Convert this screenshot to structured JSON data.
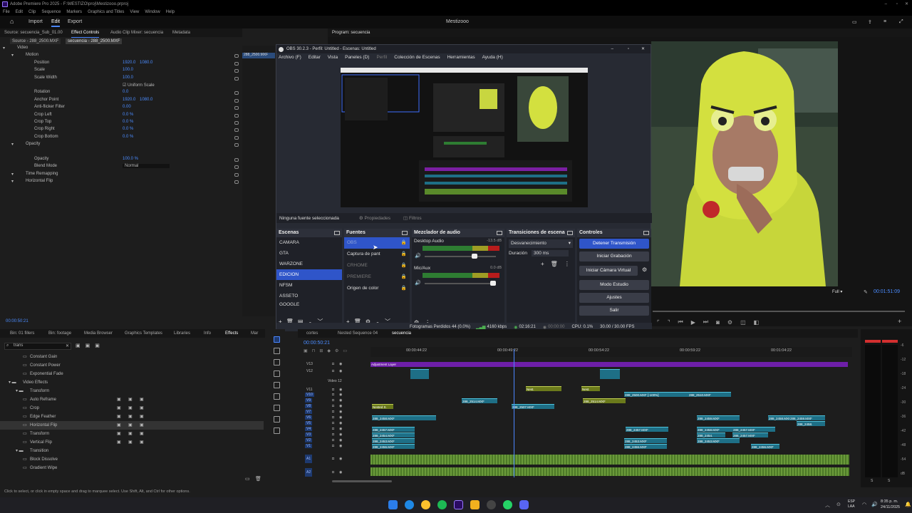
{
  "titlebar": {
    "title": "Adobe Premiere Pro 2025 - F:\\MESTIZO\\proj\\Mestizooo.prproj"
  },
  "menubar": [
    "File",
    "Edit",
    "Clip",
    "Sequence",
    "Markers",
    "Graphics and Titles",
    "View",
    "Window",
    "Help"
  ],
  "workspace": {
    "tabs": [
      "Import",
      "Edit",
      "Export"
    ],
    "active": "Edit",
    "project": "Mestizooo"
  },
  "top_panels": {
    "source": "Source: secuencia_Sub_01.00",
    "effect_controls": "Effect Controls",
    "audio_mixer": "Audio Clip Mixer: secuencia",
    "metadata": "Metadata",
    "program": "Program: secuencia"
  },
  "ec_subtabs": {
    "source": "Source - 288_2500.MXF",
    "seq": "secuencia - 288_2500.MXF",
    "clip_label": "288_2500.MXF"
  },
  "effect_controls": [
    {
      "name": "Video",
      "indent": 0,
      "v1": "",
      "v2": ""
    },
    {
      "name": "Motion",
      "indent": 1,
      "v1": "",
      "v2": ""
    },
    {
      "name": "Position",
      "indent": 2,
      "v1": "1920.0",
      "v2": "1080.0"
    },
    {
      "name": "Scale",
      "indent": 2,
      "v1": "100.0",
      "v2": ""
    },
    {
      "name": "Scale Width",
      "indent": 2,
      "v1": "100.0",
      "v2": ""
    },
    {
      "name": "",
      "indent": 2,
      "v1": "",
      "v2": "",
      "check": "Uniform Scale"
    },
    {
      "name": "Rotation",
      "indent": 2,
      "v1": "0.0",
      "v2": ""
    },
    {
      "name": "Anchor Point",
      "indent": 2,
      "v1": "1920.0",
      "v2": "1080.0"
    },
    {
      "name": "Anti-flicker Filter",
      "indent": 2,
      "v1": "0.00",
      "v2": ""
    },
    {
      "name": "Crop Left",
      "indent": 2,
      "v1": "0.0 %",
      "v2": ""
    },
    {
      "name": "Crop Top",
      "indent": 2,
      "v1": "0.0 %",
      "v2": ""
    },
    {
      "name": "Crop Right",
      "indent": 2,
      "v1": "0.0 %",
      "v2": ""
    },
    {
      "name": "Crop Bottom",
      "indent": 2,
      "v1": "0.0 %",
      "v2": ""
    },
    {
      "name": "Opacity",
      "indent": 1,
      "v1": "",
      "v2": ""
    },
    {
      "name": "",
      "indent": 2,
      "v1": "",
      "v2": ""
    },
    {
      "name": "Opacity",
      "indent": 2,
      "v1": "100.0 %",
      "v2": ""
    },
    {
      "name": "Blend Mode",
      "indent": 2,
      "v1": "Normal",
      "v2": ""
    },
    {
      "name": "Time Remapping",
      "indent": 1,
      "v1": "",
      "v2": ""
    },
    {
      "name": "Horizontal Flip",
      "indent": 1,
      "v1": "",
      "v2": ""
    }
  ],
  "ec_timecode": "00:00:50:21",
  "program": {
    "fit": "Full",
    "timecode": "00:01:51:09"
  },
  "obs": {
    "title": "OBS 30.2.3 - Perfil: Untitled - Escenas: Untitled",
    "menu": [
      "Archivo (F)",
      "Editar",
      "Vista",
      "Paneles (D)",
      "Perfil",
      "Colección de Escenas",
      "Herramientas",
      "Ayuda (H)"
    ],
    "no_source": "Ninguna fuente seleccionada",
    "properties": "Propiedades",
    "filters": "Filtros",
    "scenes_title": "Escenas",
    "scenes": [
      "CAMARA",
      "GTA",
      "WARZONE",
      "EDICION",
      "NFSM",
      "ASSETO",
      "GOOGLE"
    ],
    "active_scene": "EDICION",
    "sources_title": "Fuentes",
    "sources": [
      "OBS",
      "Captura de pant",
      "CRHOME",
      "PREMIERE",
      "Origen de color"
    ],
    "mixer_title": "Mezclador de audio",
    "mixer": [
      {
        "name": "Desktop Audio",
        "db": "-13.5 dB",
        "level": 0.72
      },
      {
        "name": "Mic/Aux",
        "db": "0.0 dB",
        "level": 1.0
      }
    ],
    "transitions_title": "Transiciones de escena",
    "transition": "Desvanecimiento",
    "duration_label": "Duración",
    "duration": "300 ms",
    "controls_title": "Controles",
    "controls": [
      "Detener Transmisión",
      "Iniciar Grabación",
      "Iniciar Cámara Virtual",
      "Modo Estudio",
      "Ajustes",
      "Salir"
    ],
    "status": {
      "dropped": "Fotogramas Perdidos 44 (0.0%)",
      "kbps": "4160 kbps",
      "live": "02:16:21",
      "rec": "00:00:00",
      "cpu": "CPU: 0.1%",
      "fps": "30.00 / 30.00 FPS"
    }
  },
  "effects_panel": {
    "tabs": [
      "Bin: 01 fillers",
      "Bin: footage",
      "Media Browser",
      "Graphics Templates",
      "Libraries",
      "Info",
      "Effects",
      "Mar"
    ],
    "active": "Effects",
    "search": "trans",
    "items": [
      {
        "name": "Constant Gain",
        "indent": 2
      },
      {
        "name": "Constant Power",
        "indent": 2
      },
      {
        "name": "Exponential Fade",
        "indent": 2
      },
      {
        "name": "Video Effects",
        "indent": 0,
        "folder": true
      },
      {
        "name": "Transform",
        "indent": 1,
        "folder": true
      },
      {
        "name": "Auto Reframe",
        "indent": 2
      },
      {
        "name": "Crop",
        "indent": 2
      },
      {
        "name": "Edge Feather",
        "indent": 2
      },
      {
        "name": "Horizontal Flip",
        "indent": 2,
        "selected": true
      },
      {
        "name": "Transform",
        "indent": 2
      },
      {
        "name": "Vertical Flip",
        "indent": 2
      },
      {
        "name": "Transition",
        "indent": 1,
        "folder": true
      },
      {
        "name": "Block Dissolve",
        "indent": 2
      },
      {
        "name": "Gradient Wipe",
        "indent": 2
      }
    ]
  },
  "timeline": {
    "tabs": [
      "cortes",
      "Nested Sequence 04",
      "secuencia"
    ],
    "active": "secuencia",
    "timecode": "00:00:50:21",
    "ruler": [
      "00:00:44:22",
      "00:00:49:22",
      "00:00:54:22",
      "00:00:59:22",
      "00:01:04:22"
    ],
    "tracks": [
      "V13",
      "V12",
      "V11",
      "V10",
      "V9",
      "V8",
      "V7",
      "V6",
      "V5",
      "V4",
      "V3",
      "V2",
      "V1",
      "A1",
      "A2"
    ],
    "track_name_v12": "Video 12",
    "labels": [
      "Adjustment Layer",
      "Nest.",
      "Nest.",
      "Nested S.",
      "288_2500.MXF [-100%]",
      "288_2510.MXF",
      "288_2514.MXF",
      "288_2514.MXF",
      "288_2507.MXF",
      "288_2458.MXF",
      "288_2457.MXF",
      "288_2454.MXF",
      "288_2453.MXF",
      "288_2456.MXF",
      "288_2459.MXF",
      "288_2457.MXF",
      "288_2458.MXF",
      "288_2457.MXF",
      "288_2454.",
      "288_2453.MXF",
      "288_2458.MXF",
      "288_2456.MXF",
      "288_2459.MXF",
      "288_2458.",
      "288_2457.MXF",
      "288_2453.MXF",
      "288_2456.MXF"
    ]
  },
  "meter_labels": [
    "-6",
    "-12",
    "-18",
    "-24",
    "-30",
    "-36",
    "-42",
    "-48",
    "-54",
    "dB"
  ],
  "status_hint": "Click to select, or click in empty space and drag to marquee select. Use Shift, Alt, and Ctrl for other options.",
  "tray": {
    "lang": "ESP\nLAA",
    "time": "8:35 p. m.",
    "date": "24/11/2025"
  }
}
